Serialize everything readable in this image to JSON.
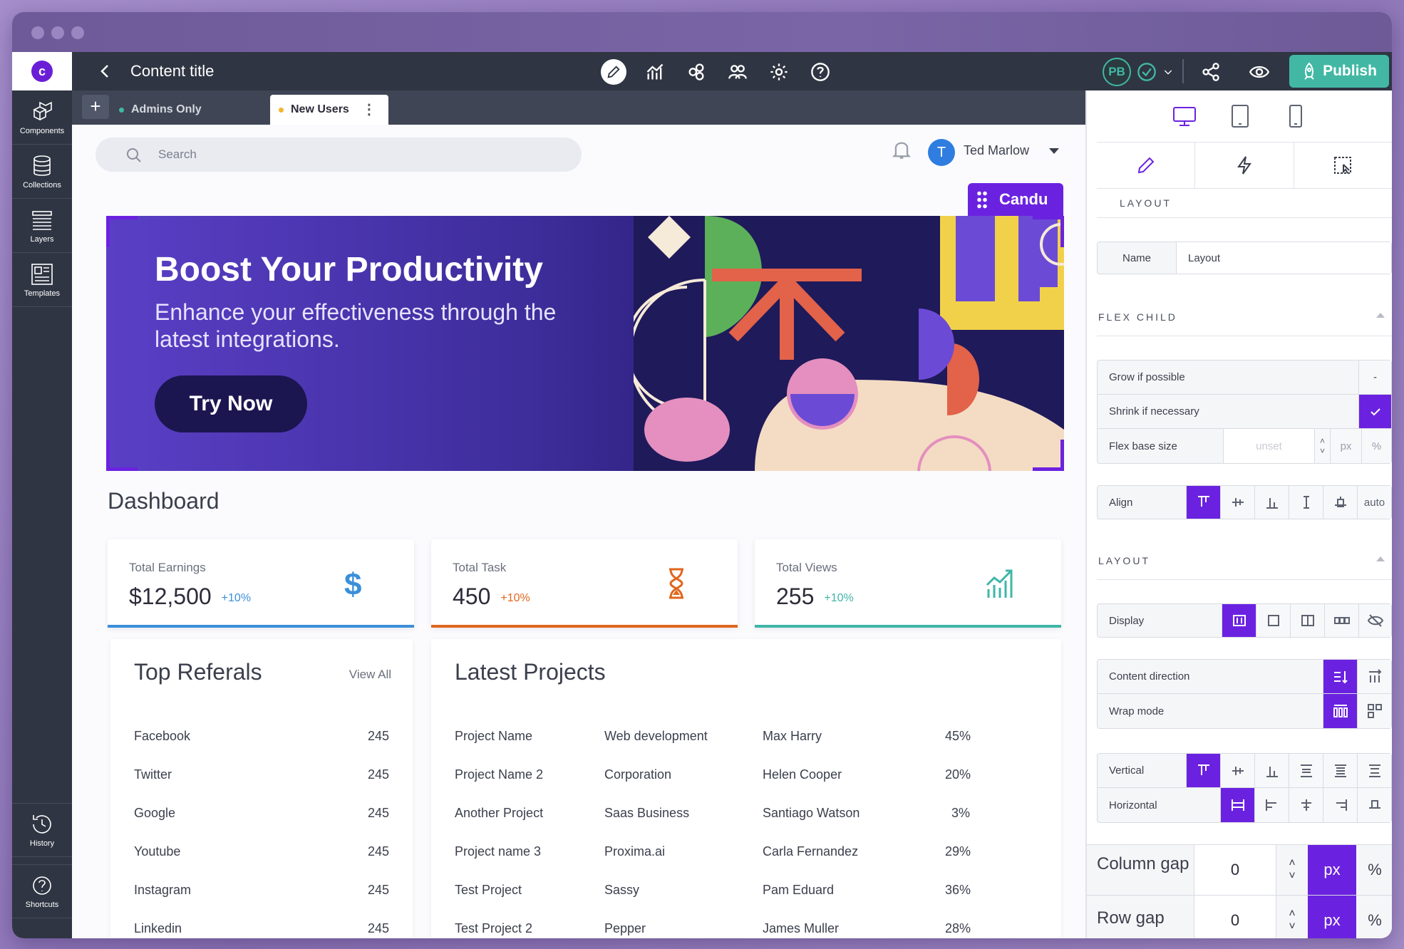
{
  "app": {
    "title": "Content title",
    "publish_label": "Publish",
    "user_initials": "PB"
  },
  "sidebar": {
    "items": [
      {
        "label": "Components",
        "icon": "cubes-icon"
      },
      {
        "label": "Collections",
        "icon": "database-icon"
      },
      {
        "label": "Layers",
        "icon": "layers-icon"
      },
      {
        "label": "Templates",
        "icon": "template-icon"
      }
    ],
    "bottom": [
      {
        "label": "History",
        "icon": "history-icon"
      },
      {
        "label": "Shortcuts",
        "icon": "help-icon"
      }
    ]
  },
  "tabs": [
    {
      "label": "Admins Only",
      "color": "#42b8a4"
    },
    {
      "label": "New Users",
      "color": "#f2b632"
    }
  ],
  "page": {
    "search_placeholder": "Search",
    "user_name": "Ted Marlow",
    "user_initial": "T",
    "candu_label": "Candu",
    "hero": {
      "title": "Boost Your Productivity",
      "subtitle": "Enhance your effectiveness through the latest integrations.",
      "cta": "Try Now"
    },
    "dashboard_title": "Dashboard",
    "stats": [
      {
        "label": "Total Earnings",
        "value": "$12,500",
        "change": "+10%",
        "color": "#3b8fd9",
        "icon": "dollar-icon"
      },
      {
        "label": "Total Task",
        "value": "450",
        "change": "+10%",
        "color": "#e0661d",
        "icon": "hourglass-icon"
      },
      {
        "label": "Total Views",
        "value": "255",
        "change": "+10%",
        "color": "#3fb6a8",
        "icon": "chart-up-icon"
      }
    ],
    "referrals": {
      "title": "Top Referals",
      "view_all": "View All",
      "rows": [
        {
          "name": "Facebook",
          "count": "245"
        },
        {
          "name": "Twitter",
          "count": "245"
        },
        {
          "name": "Google",
          "count": "245"
        },
        {
          "name": "Youtube",
          "count": "245"
        },
        {
          "name": "Instagram",
          "count": "245"
        },
        {
          "name": "Linkedin",
          "count": "245"
        }
      ]
    },
    "projects": {
      "title": "Latest Projects",
      "rows": [
        {
          "project": "Project Name",
          "company": "Web development",
          "person": "Max Harry",
          "pct": "45%"
        },
        {
          "project": "Project Name 2",
          "company": "Corporation",
          "person": "Helen Cooper",
          "pct": "20%"
        },
        {
          "project": "Another Project",
          "company": "Saas Business",
          "person": "Santiago Watson",
          "pct": "3%"
        },
        {
          "project": "Project name 3",
          "company": "Proxima.ai",
          "person": "Carla Fernandez",
          "pct": "29%"
        },
        {
          "project": "Test Project",
          "company": "Sassy",
          "person": "Pam Eduard",
          "pct": "36%"
        },
        {
          "project": "Test Project 2",
          "company": "Pepper",
          "person": "James Muller",
          "pct": "28%"
        }
      ]
    }
  },
  "inspector": {
    "layout_header": "LAYOUT",
    "name_label": "Name",
    "name_value": "Layout",
    "flex_child_header": "FLEX CHILD",
    "grow_label": "Grow if possible",
    "grow_value": "-",
    "shrink_label": "Shrink if necessary",
    "flex_base_label": "Flex base size",
    "flex_base_placeholder": "unset",
    "unit_px": "px",
    "unit_pct": "%",
    "align_label": "Align",
    "align_auto": "auto",
    "layout2_header": "LAYOUT",
    "display_label": "Display",
    "content_dir_label": "Content direction",
    "wrap_label": "Wrap mode",
    "vertical_label": "Vertical",
    "horizontal_label": "Horizontal",
    "col_gap_label": "Column gap",
    "col_gap_value": "0",
    "row_gap_label": "Row gap",
    "row_gap_value": "0"
  }
}
